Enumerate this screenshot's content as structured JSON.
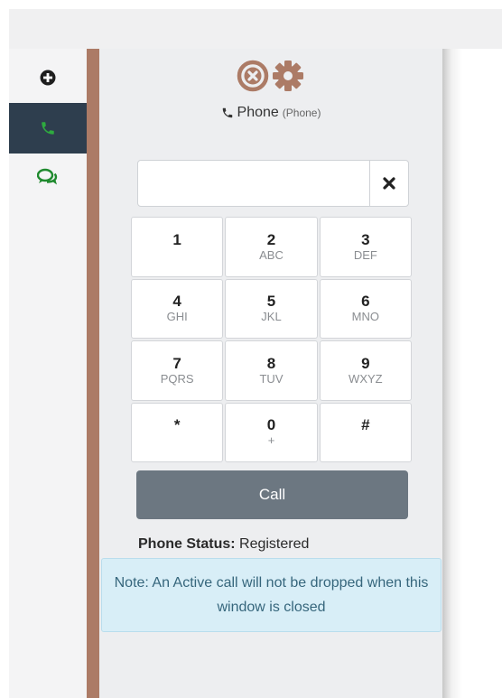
{
  "icons": {
    "add": "plus-circle-icon",
    "phone": "phone-icon",
    "chat": "chat-bubbles-icon",
    "close": "close-circle-icon",
    "settings": "gear-icon",
    "clear": "x-icon"
  },
  "colors": {
    "accent": "#ac7b66",
    "nav_active": "#2e3e4e",
    "green": "#1f8a2e",
    "call_button": "#6c7781",
    "note_bg": "#d8eef7",
    "note_text": "#36667c"
  },
  "phone": {
    "title": "Phone",
    "subtitle": "(Phone)",
    "input_value": "",
    "keypad": [
      {
        "digit": "1",
        "letters": ""
      },
      {
        "digit": "2",
        "letters": "ABC"
      },
      {
        "digit": "3",
        "letters": "DEF"
      },
      {
        "digit": "4",
        "letters": "GHI"
      },
      {
        "digit": "5",
        "letters": "JKL"
      },
      {
        "digit": "6",
        "letters": "MNO"
      },
      {
        "digit": "7",
        "letters": "PQRS"
      },
      {
        "digit": "8",
        "letters": "TUV"
      },
      {
        "digit": "9",
        "letters": "WXYZ"
      },
      {
        "digit": "*",
        "letters": ""
      },
      {
        "digit": "0",
        "letters": "+"
      },
      {
        "digit": "#",
        "letters": ""
      }
    ],
    "call_label": "Call",
    "status_label": "Phone Status:",
    "status_value": "Registered",
    "note": "Note: An Active call will not be dropped when this window is closed"
  }
}
